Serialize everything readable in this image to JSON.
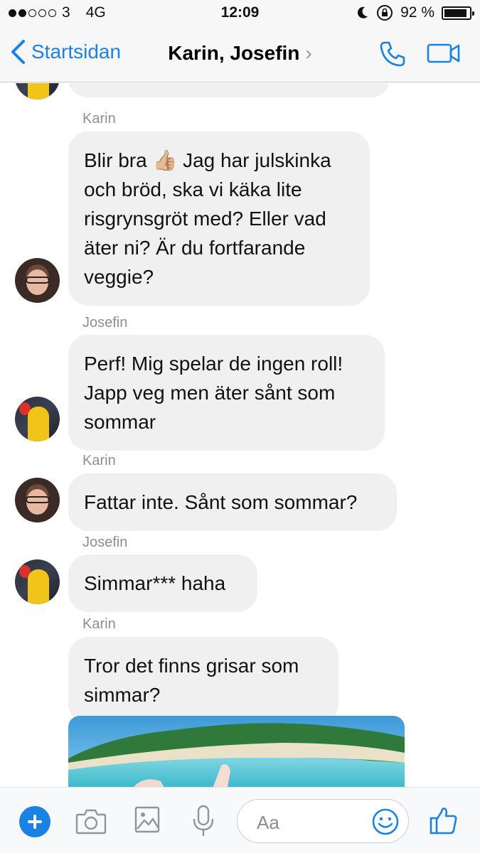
{
  "status_bar": {
    "carrier": "3",
    "network": "4G",
    "time": "12:09",
    "battery": "92 %",
    "battery_level": 0.92,
    "signal_bars_filled": 2
  },
  "nav": {
    "back_label": "Startsidan",
    "title": "Karin, Josefin",
    "title_chevron": "›",
    "accent_color": "#1a82e2"
  },
  "messages": [
    {
      "sender": "Karin",
      "text": "Blir bra 👍🏼 Jag har julskinka\noch bröd, ska vi käka lite\nrisgrynsgröt med? Eller vad\näter ni? Är du fortfarande\nveggie?"
    },
    {
      "sender": "Josefin",
      "text": "Perf! Mig spelar de ingen roll!\nJapp veg men äter sånt som\nsommar"
    },
    {
      "sender": "Karin",
      "text": "Fattar inte. Sånt som sommar?"
    },
    {
      "sender": "Josefin",
      "text": "Simmar*** haha"
    },
    {
      "sender": "Karin",
      "text": "Tror det finns grisar som\nsimmar?"
    }
  ],
  "composer": {
    "placeholder": "Aa"
  }
}
